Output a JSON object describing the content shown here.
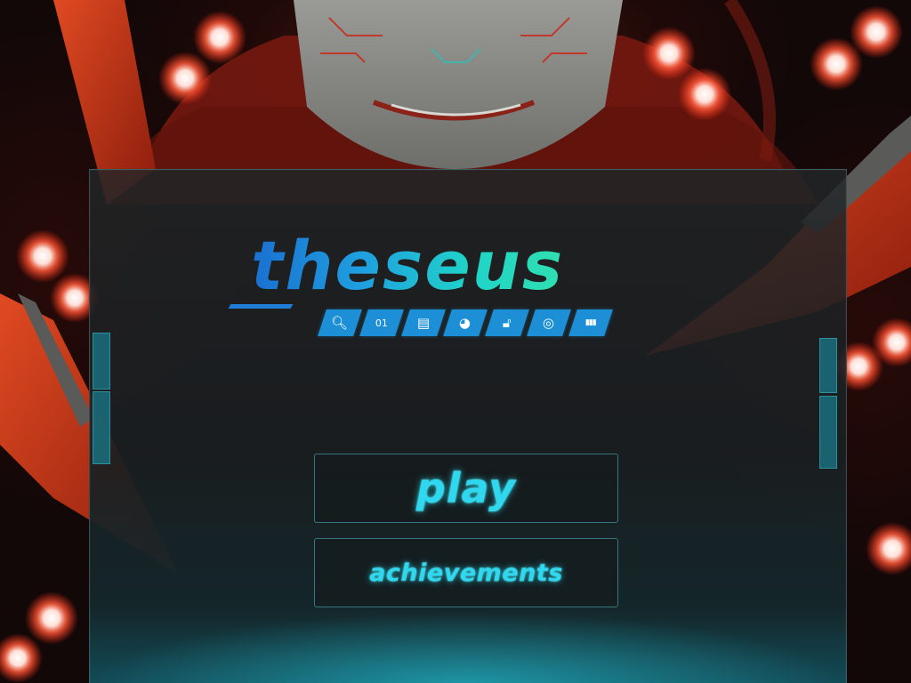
{
  "game": {
    "title": "theseus"
  },
  "feature_icons": [
    {
      "name": "magnifier-icon",
      "glyph": "🔍︎"
    },
    {
      "name": "binary-icon",
      "glyph": "01"
    },
    {
      "name": "document-icon",
      "glyph": "▤"
    },
    {
      "name": "globe-icon",
      "glyph": "◕"
    },
    {
      "name": "padlock-icon",
      "glyph": "🔓︎"
    },
    {
      "name": "spiral-icon",
      "glyph": "◎"
    },
    {
      "name": "barcode-icon",
      "glyph": "▮▮▮"
    }
  ],
  "menu": {
    "play_label": "play",
    "achievements_label": "achievements"
  },
  "colors": {
    "accent_cyan": "#2fd8ee",
    "logo_blue": "#1f7fd8",
    "logo_teal": "#20d3c8",
    "robot_red": "#c23a1c",
    "icon_blue": "#1c8fd6"
  }
}
